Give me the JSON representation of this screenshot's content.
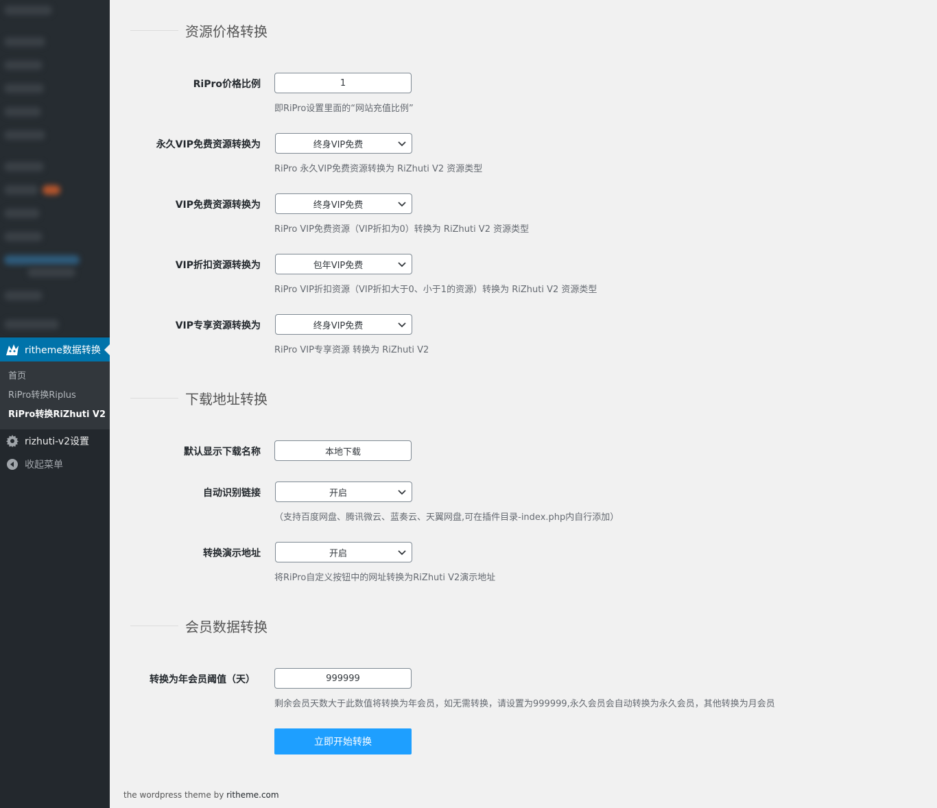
{
  "sidebar": {
    "current_menu": "ritheme数据转换",
    "submenu": [
      "首页",
      "RiPro转换Riplus",
      "RiPro转换RiZhuti V2"
    ],
    "settings_item": "rizhuti-v2设置",
    "collapse_item": "收起菜单",
    "colors": {
      "bg": "#23282d",
      "current": "#0073aa",
      "submenu_bg": "#32373c"
    }
  },
  "sections": {
    "price": "资源价格转换",
    "download": "下载地址转换",
    "member": "会员数据转换"
  },
  "price": {
    "ratio_label": "RiPro价格比例",
    "ratio_value": "1",
    "ratio_desc": "即RiPro设置里面的“网站充值比例”",
    "forever_free_label": "永久VIP免费资源转换为",
    "forever_free_value": "终身VIP免费",
    "forever_free_desc": "RiPro 永久VIP免费资源转换为 RiZhuti V2 资源类型",
    "vip_free_label": "VIP免费资源转换为",
    "vip_free_value": "终身VIP免费",
    "vip_free_desc": "RiPro VIP免费资源（VIP折扣为0）转换为 RiZhuti V2 资源类型",
    "vip_discount_label": "VIP折扣资源转换为",
    "vip_discount_value": "包年VIP免费",
    "vip_discount_desc": "RiPro VIP折扣资源（VIP折扣大于0、小于1的资源）转换为 RiZhuti V2 资源类型",
    "vip_exclusive_label": "VIP专享资源转换为",
    "vip_exclusive_value": "终身VIP免费",
    "vip_exclusive_desc": "RiPro VIP专享资源 转换为 RiZhuti V2"
  },
  "download": {
    "name_label": "默认显示下载名称",
    "name_value": "本地下载",
    "auto_label": "自动识别链接",
    "auto_value": "开启",
    "auto_desc": "（支持百度网盘、腾讯微云、蓝奏云、天翼网盘,可在插件目录-index.php内自行添加）",
    "demo_label": "转换演示地址",
    "demo_value": "开启",
    "demo_desc": "将RiPro自定义按钮中的网址转换为RiZhuti V2演示地址"
  },
  "member": {
    "threshold_label": "转换为年会员阈值（天）",
    "threshold_value": "999999",
    "threshold_desc": "剩余会员天数大于此数值将转换为年会员，如无需转换，请设置为999999,永久会员会自动转换为永久会员，其他转换为月会员"
  },
  "submit_label": "立即开始转换",
  "footer": {
    "text": "the wordpress theme by ",
    "link": "ritheme.com"
  },
  "accent_color": "#1e9fff"
}
